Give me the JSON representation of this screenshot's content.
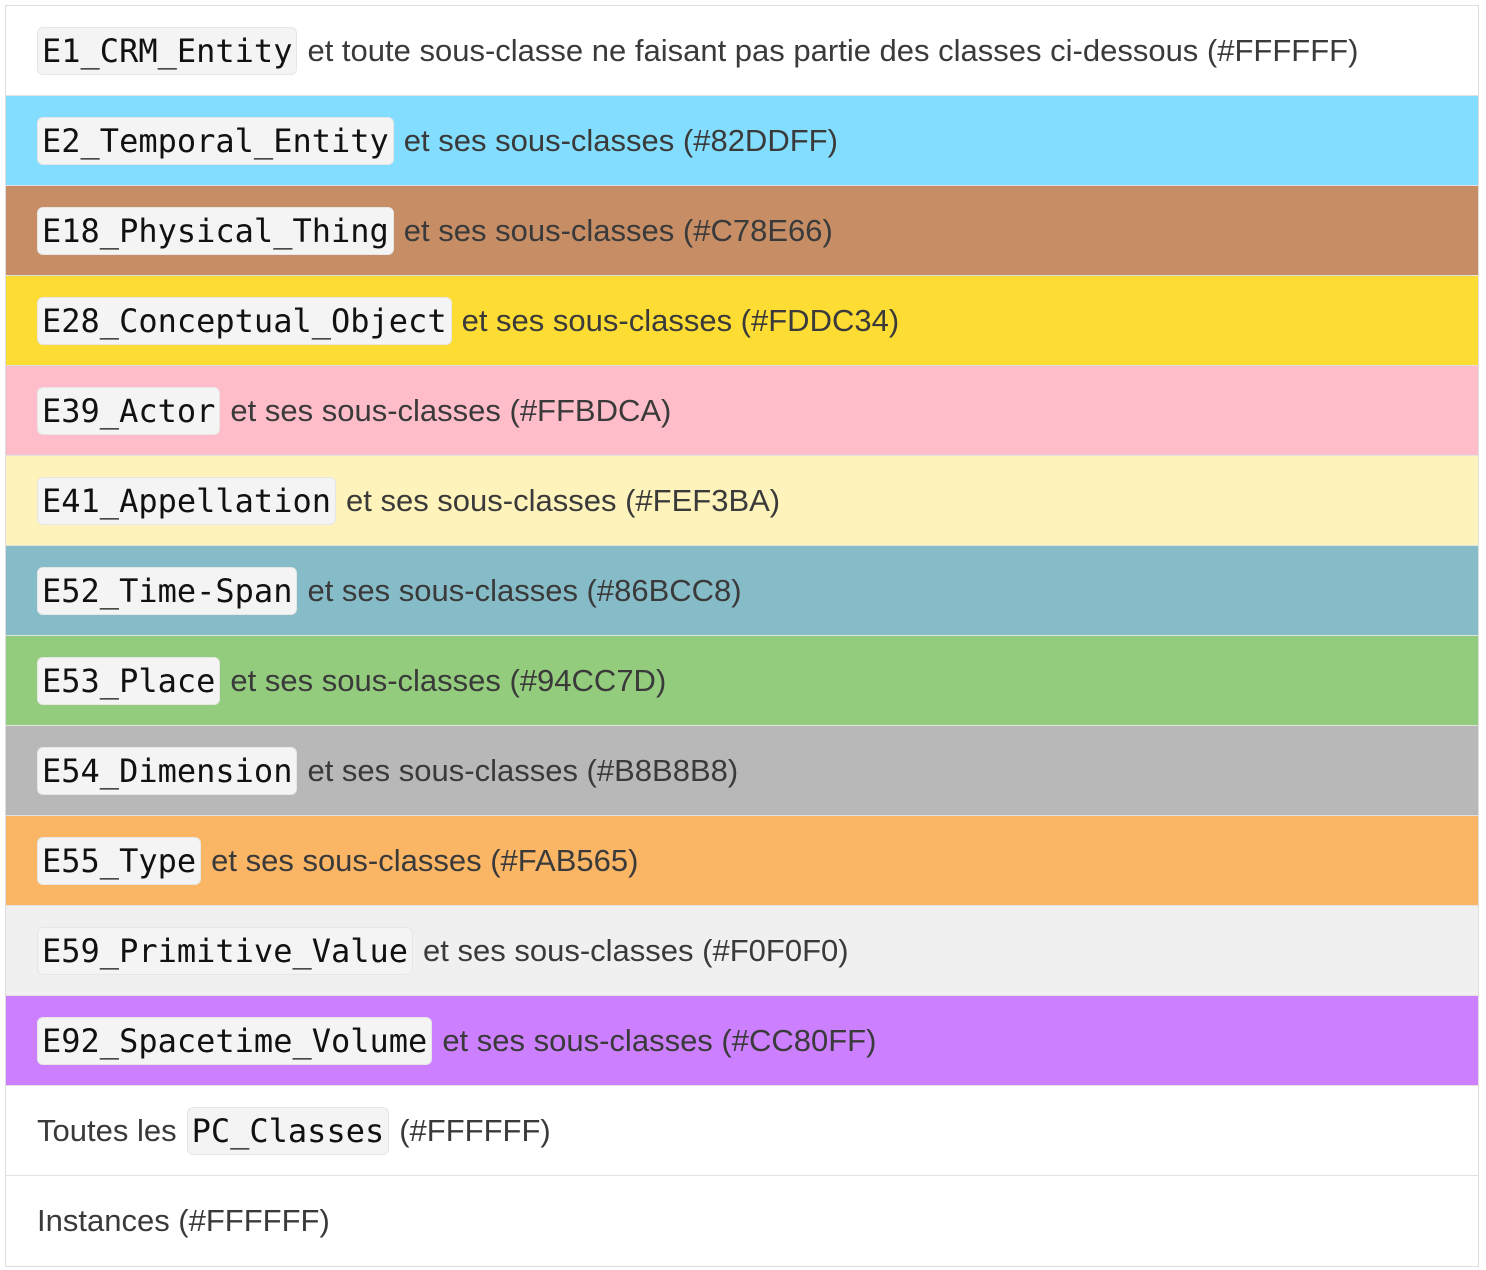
{
  "rows": [
    {
      "code": "E1_CRM_Entity",
      "desc": "et toute sous-classe ne faisant pas partie des classes ci-dessous (#FFFFFF)",
      "color": "#FFFFFF"
    },
    {
      "code": "E2_Temporal_Entity",
      "desc": "et ses sous-classes (#82DDFF)",
      "color": "#82DDFF"
    },
    {
      "code": "E18_Physical_Thing",
      "desc": "et ses sous-classes (#C78E66)",
      "color": "#C78E66"
    },
    {
      "code": "E28_Conceptual_Object",
      "desc": "et ses sous-classes (#FDDC34)",
      "color": "#FDDC34"
    },
    {
      "code": "E39_Actor",
      "desc": "et ses sous-classes (#FFBDCA)",
      "color": "#FFBDCA"
    },
    {
      "code": "E41_Appellation",
      "desc": "et ses sous-classes (#FEF3BA)",
      "color": "#FEF3BA"
    },
    {
      "code": "E52_Time-Span",
      "desc": "et ses sous-classes (#86BCC8)",
      "color": "#86BCC8"
    },
    {
      "code": "E53_Place",
      "desc": "et ses sous-classes (#94CC7D)",
      "color": "#94CC7D"
    },
    {
      "code": "E54_Dimension",
      "desc": "et ses sous-classes (#B8B8B8)",
      "color": "#B8B8B8"
    },
    {
      "code": "E55_Type",
      "desc": "et ses sous-classes (#FAB565)",
      "color": "#FAB565"
    },
    {
      "code": "E59_Primitive_Value",
      "desc": "et ses sous-classes (#F0F0F0)",
      "color": "#F0F0F0"
    },
    {
      "code": "E92_Spacetime_Volume",
      "desc": "et ses sous-classes (#CC80FF)",
      "color": "#CC80FF"
    }
  ],
  "pc_row": {
    "prefix": "Toutes les",
    "code": "PC_Classes",
    "desc": "(#FFFFFF)",
    "color": "#FFFFFF"
  },
  "instances_row": {
    "desc": "Instances (#FFFFFF)",
    "color": "#FFFFFF"
  }
}
